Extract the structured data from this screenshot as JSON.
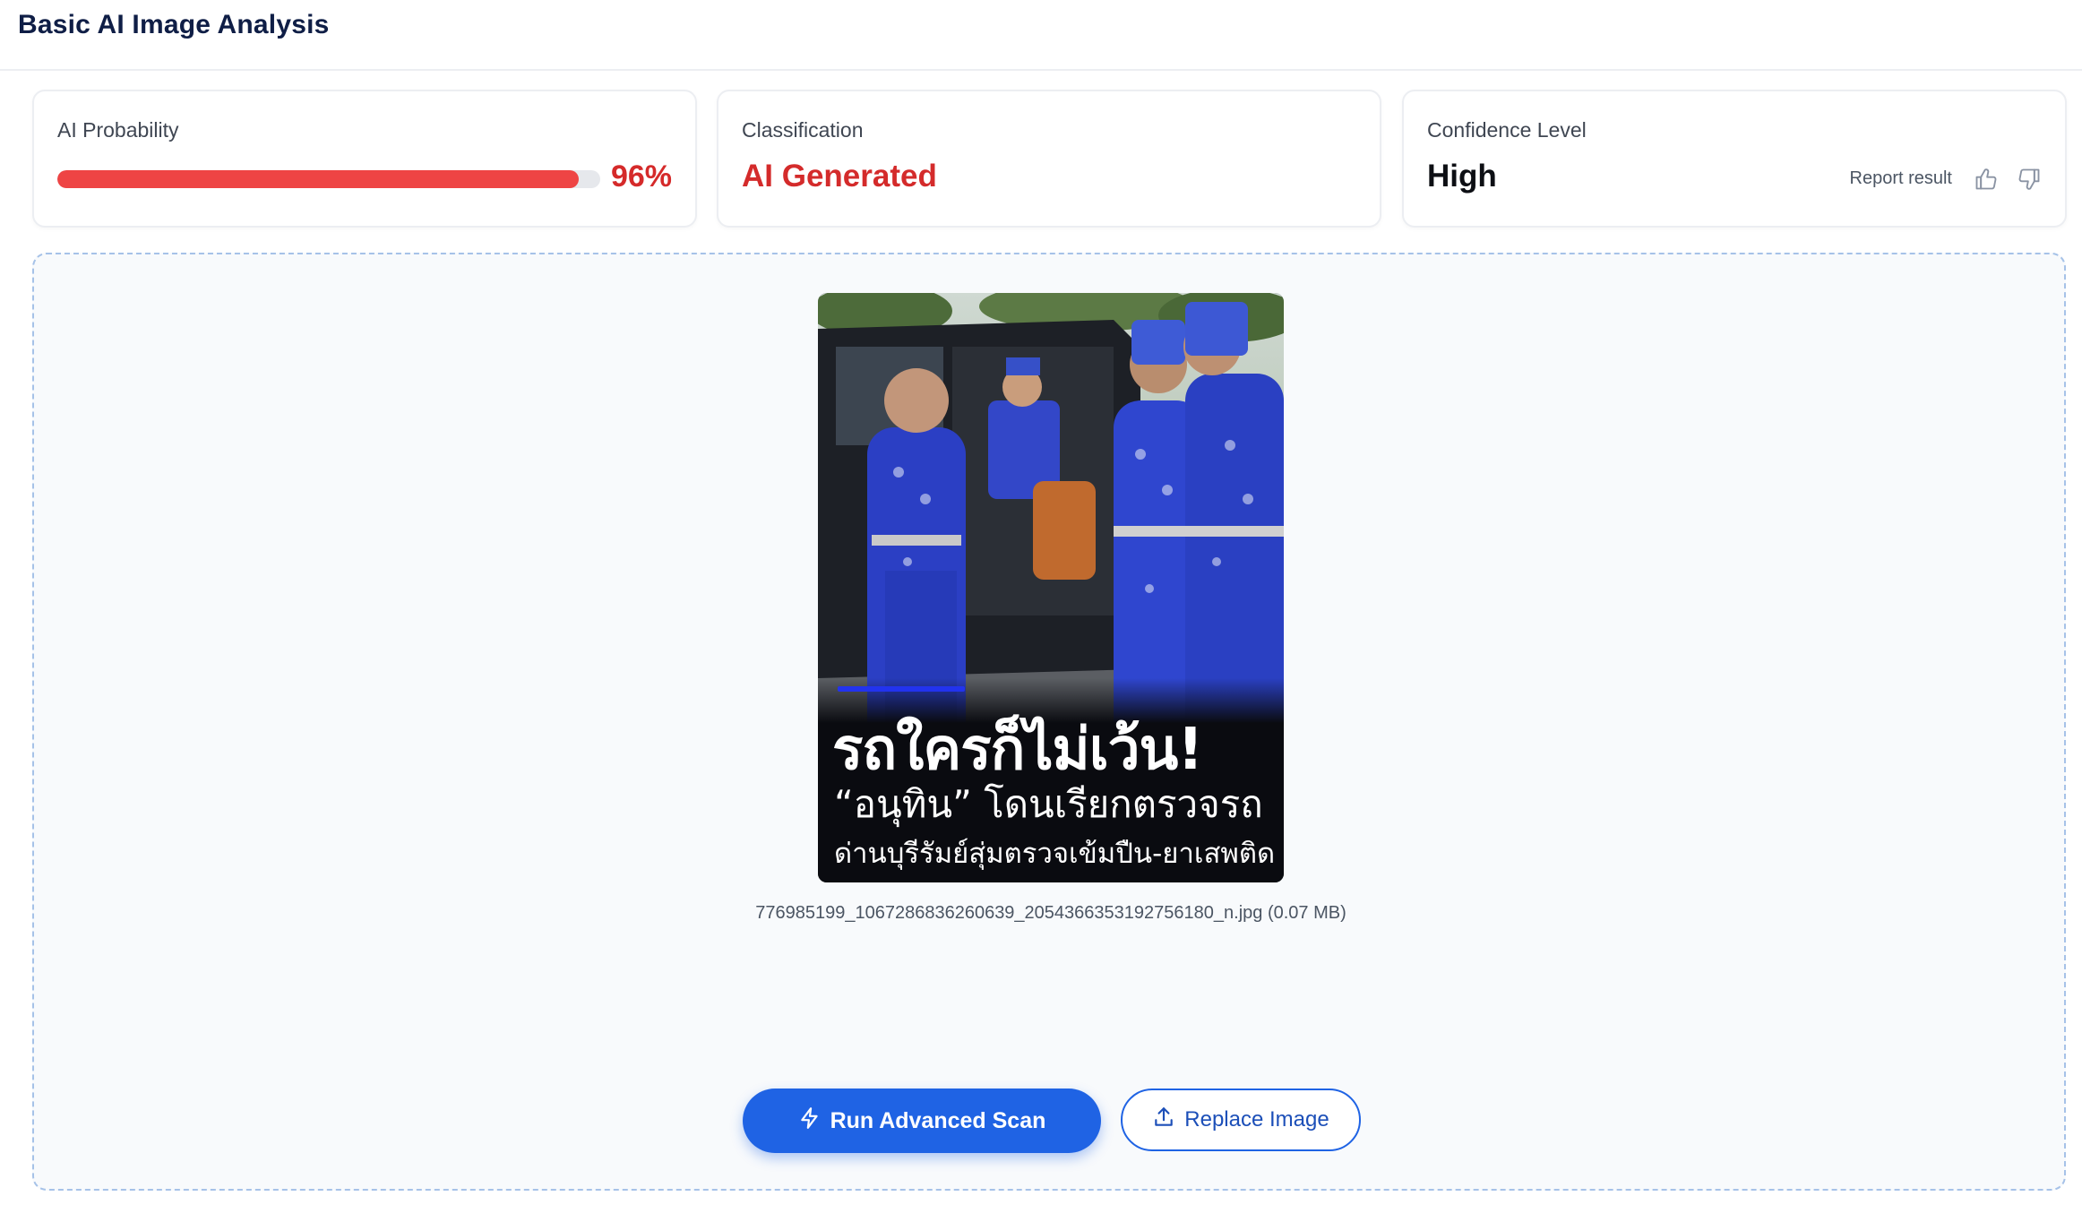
{
  "header": {
    "title": "Basic AI Image Analysis"
  },
  "probability": {
    "label": "AI Probability",
    "value_text": "96%",
    "value": 0.96,
    "bar_color": "#ee4444"
  },
  "classification": {
    "label": "Classification",
    "value": "AI Generated",
    "color": "#d42b2b"
  },
  "confidence": {
    "label": "Confidence Level",
    "value": "High",
    "report_label": "Report result",
    "thumbs_up_icon": "thumbs-up-icon",
    "thumbs_down_icon": "thumbs-down-icon"
  },
  "preview": {
    "caption_line1": "รถใครก็ไม่เว้น!",
    "caption_line2": "“อนุทิน” โดนเรียกตรวจรถ",
    "caption_line3": "ด่านบุรีรัมย์สุ่มตรวจเข้มปืน-ยาเสพติด",
    "file_name": "776985199_1067286836260639_2054366353192756180_n.jpg",
    "file_size": "(0.07 MB)"
  },
  "actions": {
    "scan_label": "Run Advanced Scan",
    "scan_icon": "lightning-icon",
    "replace_label": "Replace Image",
    "replace_icon": "upload-icon",
    "accent_color": "#1f63e4"
  }
}
